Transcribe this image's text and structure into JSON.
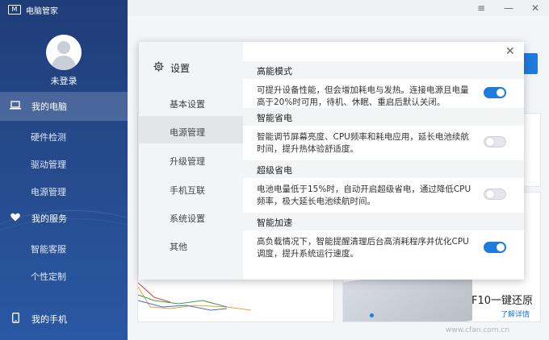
{
  "app": {
    "title": "电脑管家",
    "logo_text": "M"
  },
  "user": {
    "name": "未登录"
  },
  "sidebar": {
    "my_computer": "我的电脑",
    "sub_computer": [
      "硬件检测",
      "驱动管理",
      "电源管理"
    ],
    "my_service": "我的服务",
    "sub_service": [
      "智能客服",
      "个性定制"
    ],
    "my_phone": "我的手机"
  },
  "window_controls": {
    "menu": "≡",
    "minimize": "—",
    "close": "✕"
  },
  "background": {
    "restore_title": "F10一键还原",
    "learn_more": "了解详情"
  },
  "dialog": {
    "title": "设置",
    "close": "✕",
    "menu": [
      "基本设置",
      "电源管理",
      "升级管理",
      "手机互联",
      "系统设置",
      "其他"
    ],
    "selected_menu": "电源管理",
    "sections": [
      {
        "title": "高能模式",
        "desc": "可提升设备性能，但会增加耗电与发热。连接电源且电量高于20%时可用，待机、休眠、重启后默认关闭。",
        "enabled": true
      },
      {
        "title": "智能省电",
        "desc": "智能调节屏幕亮度、CPU频率和耗电应用，延长电池续航时间，提升热体验舒适度。",
        "enabled": false
      },
      {
        "title": "超级省电",
        "desc": "电池电量低于15%时，自动开启超级省电，通过降低CPU频率，极大延长电池续航时间。",
        "enabled": false
      },
      {
        "title": "智能加速",
        "desc": "高负载情况下，智能提醒清理后台高消耗程序并优化CPU调度，提升系统运行速度。",
        "enabled": true
      }
    ]
  },
  "watermark": "www.cfan.com.cn",
  "colors": {
    "accent": "#1f7ae0",
    "sidebar": "#264c8f"
  }
}
